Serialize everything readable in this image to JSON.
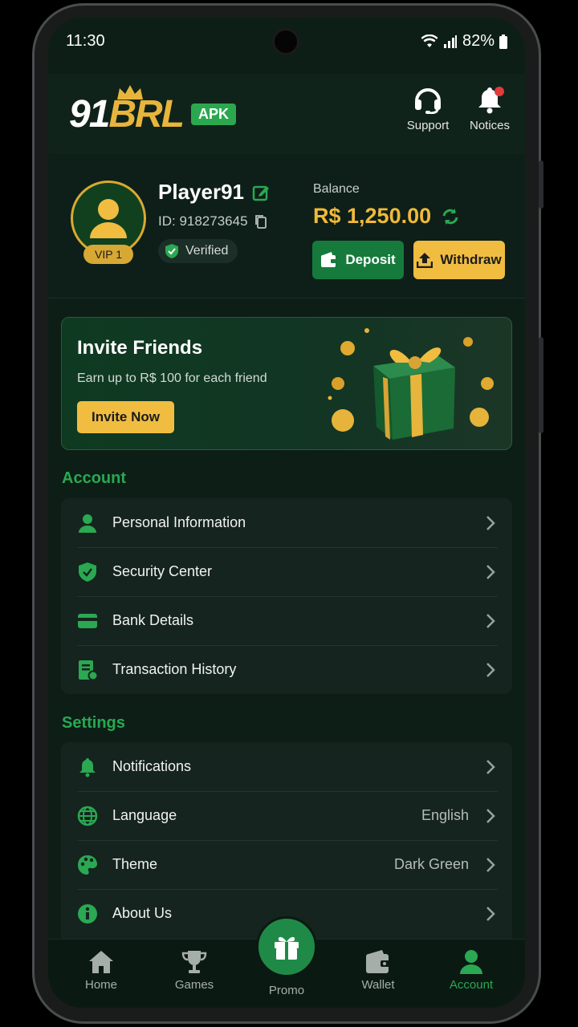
{
  "status_bar": {
    "time": "11:30",
    "battery": "82%"
  },
  "header": {
    "logo_number": "91",
    "logo_brand": "BRL",
    "logo_tag": "APK",
    "support_label": "Support",
    "notices_label": "Notices"
  },
  "profile": {
    "name": "Player91",
    "id_text": "ID: 918273645",
    "vip": "VIP 1",
    "verified": "Verified",
    "balance_label": "Balance",
    "balance_value": "R$ 1,250.00",
    "deposit_label": "Deposit",
    "withdraw_label": "Withdraw"
  },
  "invite": {
    "title": "Invite Friends",
    "subtitle": "Earn up to R$ 100 for each friend",
    "button": "Invite Now"
  },
  "account": {
    "title": "Account",
    "items": [
      {
        "label": "Personal Information",
        "icon": "person-icon"
      },
      {
        "label": "Security Center",
        "icon": "shield-icon"
      },
      {
        "label": "Bank Details",
        "icon": "card-icon"
      },
      {
        "label": "Transaction History",
        "icon": "receipt-icon"
      }
    ]
  },
  "settings": {
    "title": "Settings",
    "items": [
      {
        "label": "Notifications",
        "value": "",
        "icon": "bell-icon"
      },
      {
        "label": "Language",
        "value": "English",
        "icon": "globe-icon"
      },
      {
        "label": "Theme",
        "value": "Dark Green",
        "icon": "palette-icon"
      },
      {
        "label": "About Us",
        "value": "",
        "icon": "info-icon"
      }
    ]
  },
  "nav": {
    "home": "Home",
    "games": "Games",
    "promo": "Promo",
    "wallet": "Wallet",
    "account": "Account",
    "active": "Account"
  },
  "colors": {
    "accent_green": "#2aa852",
    "gold": "#f0bd41",
    "background": "#0d1e17"
  }
}
